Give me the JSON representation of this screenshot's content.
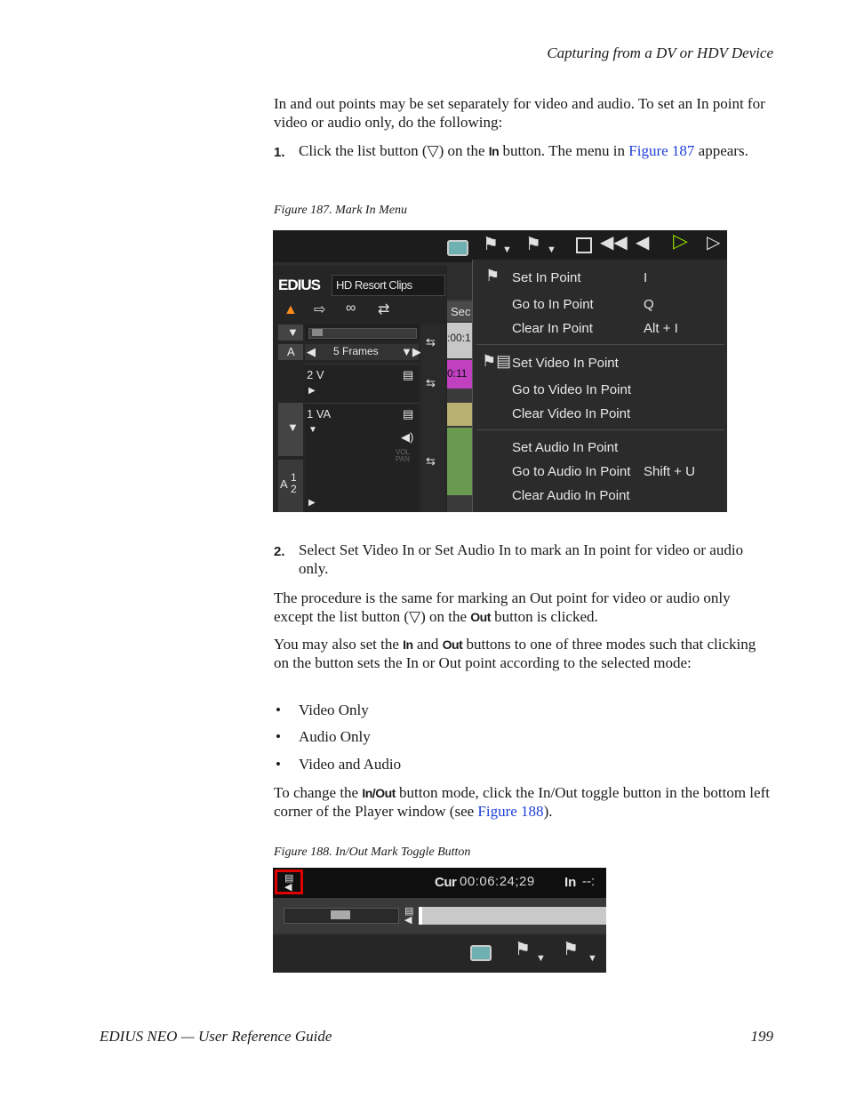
{
  "header": {
    "title": "Capturing from a DV or HDV Device"
  },
  "intro": "In and out points may be set separately for video and audio. To set an In point for video or audio only, do the following:",
  "step1": {
    "number": "1.",
    "part1": "Click the list button (▽) on the ",
    "in_label": "In",
    "part2": " button. The menu in ",
    "link": "Figure 187",
    "part3": " appears."
  },
  "figure187": {
    "caption": "Figure 187.  Mark In Menu",
    "brand": "EDIUS",
    "bin_name": "HD Resort Clips",
    "tab_stub": "Sec",
    "frames": "5 Frames",
    "track_2v": "2 V",
    "track_1va": "1 VA",
    "vol": "VOL",
    "pan": "PAN",
    "a_label": "A",
    "a_nums": "1\n2",
    "timecode1": ":00:1",
    "timecode2": "0:11",
    "menu": [
      {
        "label": "Set In Point",
        "shortcut": "I"
      },
      {
        "label": "Go to In Point",
        "shortcut": "Q"
      },
      {
        "label": "Clear In Point",
        "shortcut": "Alt + I"
      },
      {
        "label": "Set Video In Point",
        "shortcut": ""
      },
      {
        "label": "Go to Video In Point",
        "shortcut": ""
      },
      {
        "label": "Clear Video In Point",
        "shortcut": ""
      },
      {
        "label": "Set Audio In Point",
        "shortcut": ""
      },
      {
        "label": "Go to Audio In Point",
        "shortcut": "Shift + U"
      },
      {
        "label": "Clear Audio In Point",
        "shortcut": ""
      }
    ]
  },
  "step2": {
    "number": "2.",
    "text": "Select Set Video In or Set Audio In to mark an In point for video or audio only."
  },
  "para_procedure": {
    "part1": "The procedure is the same for marking an Out point for video or audio only except the list button (▽) on the ",
    "out_label": "Out",
    "part2": " button is clicked."
  },
  "para_modes": {
    "part1": "You may also set the ",
    "in_label": "In",
    "part2": " and ",
    "out_label": "Out",
    "part3": " buttons to one of three modes such that clicking on the button sets the In or Out point according to the selected mode:"
  },
  "bullets": [
    "Video Only",
    "Audio Only",
    "Video and Audio"
  ],
  "bullet_char": "•",
  "para_toggle": {
    "part1": "To change the ",
    "inout_label": "In/Out",
    "part2": " button mode, click the In/Out toggle button in the bottom left corner of the Player window (see ",
    "link": "Figure 188",
    "part3": ")."
  },
  "figure188": {
    "caption": "Figure 188.  In/Out Mark Toggle Button",
    "cur_label": "Cur",
    "cur_value": "00:06:24;29",
    "in_label": "In",
    "in_value": "--:"
  },
  "footer": {
    "title": "EDIUS NEO  —  User Reference Guide",
    "page": "199"
  },
  "colors": {
    "link": "#1f3fd8",
    "highlight_red": "#e00000",
    "play_green": "#8fd400"
  }
}
